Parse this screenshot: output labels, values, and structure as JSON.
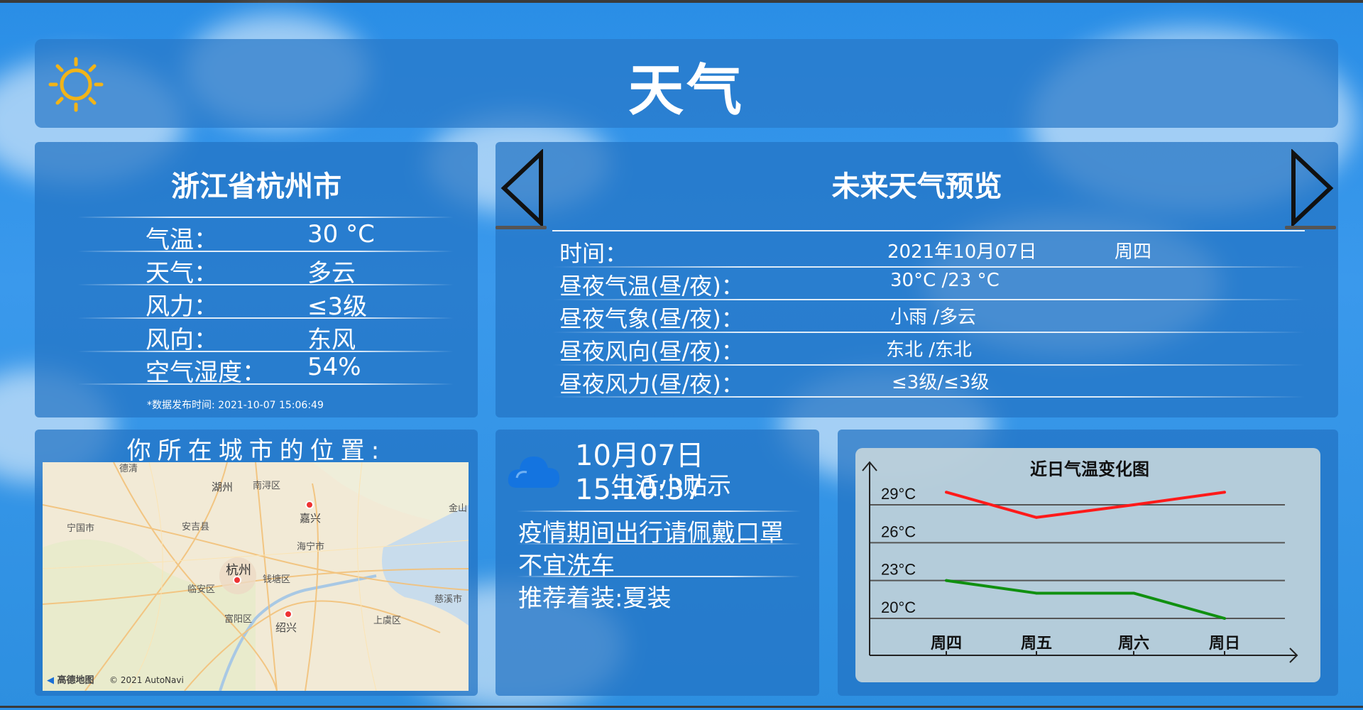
{
  "header": {
    "title": "天气",
    "icon": "sun-icon"
  },
  "city": {
    "name": "浙江省杭州市",
    "rows": [
      {
        "label": "气温：",
        "value": "30 °C"
      },
      {
        "label": "天气：",
        "value": "多云"
      },
      {
        "label": "风力：",
        "value": "≤3级"
      },
      {
        "label": "风向：",
        "value": "东风"
      },
      {
        "label": "空气湿度：",
        "value": "54%"
      }
    ],
    "publish_time": "*数据发布时间: 2021-10-07 15:06:49"
  },
  "forecast": {
    "title": "未来天气预览",
    "prev_icon": "chevron-left-icon",
    "next_icon": "chevron-right-icon",
    "rows": [
      {
        "label": "时间：",
        "value": "2021年10月07日",
        "extra": "周四"
      },
      {
        "label": "昼夜气温(昼/夜)：",
        "value": "30°C /23 °C"
      },
      {
        "label": "昼夜气象(昼/夜)：",
        "value": "小雨 /多云"
      },
      {
        "label": "昼夜风向(昼/夜)：",
        "value": "东北 /东北"
      },
      {
        "label": "昼夜风力(昼/夜)：",
        "value": "≤3级/≤3级"
      }
    ]
  },
  "map": {
    "title": "你所在城市的位置:",
    "labels": {
      "huzhou": "湖州",
      "nanxun": "南浔区",
      "deqing": "德清",
      "jiaxing": "嘉兴",
      "jinshan": "金山",
      "ningguo": "宁国市",
      "anji": "安吉县",
      "haining": "海宁市",
      "hangzhou": "杭州",
      "qiantang": "钱塘区",
      "linan": "临安区",
      "cixi": "慈溪市",
      "fuyang": "富阳区",
      "shaoxing": "绍兴",
      "shangyu": "上虞区"
    },
    "logo": "高德地图",
    "copyright": "© 2021 AutoNavi"
  },
  "tips": {
    "time": "10月07日15:10:37",
    "title": "生活小贴示",
    "icon": "cloud-icon",
    "items": [
      "疫情期间出行请佩戴口罩",
      "不宜洗车",
      "推荐着装:夏装"
    ]
  },
  "chart_data": {
    "type": "line",
    "title": "近日气温变化图",
    "categories": [
      "周四",
      "周五",
      "周六",
      "周日"
    ],
    "y_ticks": [
      "29°C",
      "26°C",
      "23°C",
      "20°C"
    ],
    "series": [
      {
        "color": "#ff1a1a",
        "values": [
          30,
          28,
          29,
          30
        ]
      },
      {
        "color": "#109010",
        "values": [
          23,
          22,
          22,
          20
        ]
      }
    ],
    "grid": true
  },
  "colors": {
    "panel": "#2373c3",
    "background": "#2a8ee6"
  }
}
